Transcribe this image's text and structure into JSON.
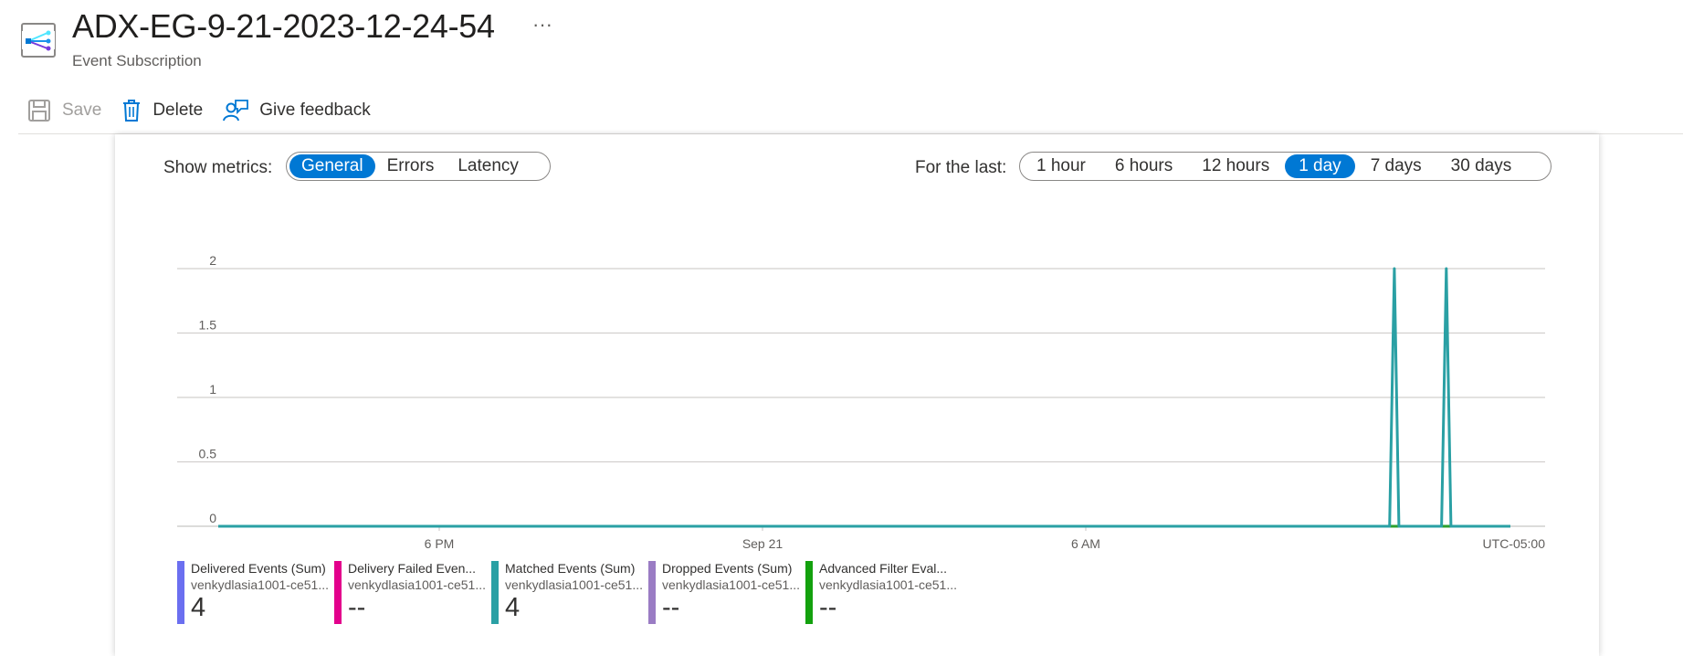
{
  "header": {
    "title": "ADX-EG-9-21-2023-12-24-54",
    "subtitle": "Event Subscription",
    "more_label": "···"
  },
  "toolbar": {
    "save_label": "Save",
    "delete_label": "Delete",
    "feedback_label": "Give feedback"
  },
  "metrics": {
    "label": "Show metrics:",
    "options": [
      "General",
      "Errors",
      "Latency"
    ],
    "selected": "General"
  },
  "time_range": {
    "label": "For the last:",
    "options": [
      "1 hour",
      "6 hours",
      "12 hours",
      "1 day",
      "7 days",
      "30 days"
    ],
    "selected": "1 day"
  },
  "chart_data": {
    "type": "line",
    "y_ticks": [
      "2",
      "1.5",
      "1",
      "0.5",
      "0"
    ],
    "ylim": [
      0,
      2
    ],
    "x_ticks": [
      "6 PM",
      "Sep 21",
      "6 AM"
    ],
    "timezone_label": "UTC-05:00",
    "grid": true,
    "series": [
      {
        "name": "Delivered Events (Sum)",
        "color": "#2ca02c",
        "points": [
          [
            0.0,
            0
          ],
          [
            1.0,
            0
          ]
        ]
      },
      {
        "name": "Matched Events (Sum)",
        "color": "#2aa0a4",
        "points": [
          [
            0.0,
            0
          ],
          [
            0.9065,
            0
          ],
          [
            0.9102,
            2
          ],
          [
            0.9137,
            0
          ],
          [
            0.9467,
            0
          ],
          [
            0.9504,
            2
          ],
          [
            0.954,
            0
          ],
          [
            1.0,
            0
          ]
        ]
      }
    ]
  },
  "legend": [
    {
      "name": "Delivered Events (Sum)",
      "resource": "venkydlasia1001-ce51...",
      "value": "4",
      "color": "#6b6ff0"
    },
    {
      "name": "Delivery Failed Even...",
      "resource": "venkydlasia1001-ce51...",
      "value": "--",
      "color": "#e3008c"
    },
    {
      "name": "Matched Events (Sum)",
      "resource": "venkydlasia1001-ce51...",
      "value": "4",
      "color": "#2aa0a4"
    },
    {
      "name": "Dropped Events (Sum)",
      "resource": "venkydlasia1001-ce51...",
      "value": "--",
      "color": "#9a7cc4"
    },
    {
      "name": "Advanced Filter Eval...",
      "resource": "venkydlasia1001-ce51...",
      "value": "--",
      "color": "#13a10e"
    }
  ],
  "icons": [
    "event-subscription-icon",
    "save-icon",
    "delete-icon",
    "feedback-icon"
  ]
}
